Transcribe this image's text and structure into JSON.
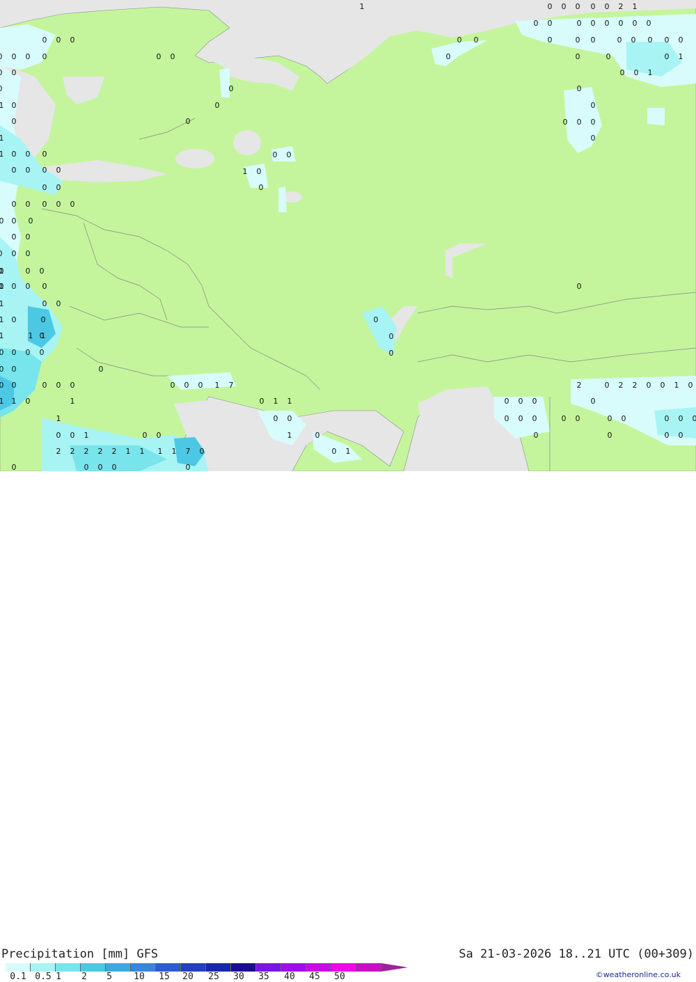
{
  "map": {
    "land_color": "#c4f59c",
    "sea_color": "#e6e6e6",
    "precip_values": [
      {
        "v": "0"
      },
      {
        "v": "0"
      },
      {
        "v": "0"
      },
      {
        "v": "0"
      },
      {
        "v": "0"
      },
      {
        "v": "0"
      },
      {
        "v": "0"
      },
      {
        "v": "0"
      },
      {
        "v": "0"
      },
      {
        "v": "0"
      },
      {
        "v": "0"
      },
      {
        "v": "0"
      },
      {
        "v": "0"
      },
      {
        "v": "0"
      },
      {
        "v": "0"
      },
      {
        "v": "0"
      },
      {
        "v": "0"
      },
      {
        "v": "0"
      },
      {
        "v": "0"
      },
      {
        "v": "0"
      },
      {
        "v": "0"
      },
      {
        "v": "0"
      },
      {
        "v": "0"
      },
      {
        "v": "0"
      },
      {
        "v": "0"
      },
      {
        "v": "0"
      },
      {
        "v": "0"
      },
      {
        "v": "1"
      },
      {
        "v": "0"
      },
      {
        "v": "0"
      },
      {
        "v": "1"
      },
      {
        "v": "0"
      },
      {
        "v": "0"
      },
      {
        "v": "0"
      },
      {
        "v": "0"
      },
      {
        "v": "0"
      },
      {
        "v": "0"
      },
      {
        "v": "0"
      },
      {
        "v": "0"
      },
      {
        "v": "0"
      },
      {
        "v": "0"
      },
      {
        "v": "0"
      },
      {
        "v": "1"
      },
      {
        "v": "0"
      },
      {
        "v": "0"
      },
      {
        "v": "0"
      },
      {
        "v": "0"
      },
      {
        "v": "0"
      },
      {
        "v": "0"
      },
      {
        "v": "1"
      },
      {
        "v": "0"
      },
      {
        "v": "0"
      },
      {
        "v": "0"
      },
      {
        "v": "0"
      },
      {
        "v": "0"
      },
      {
        "v": "1"
      },
      {
        "v": "0"
      },
      {
        "v": "0"
      },
      {
        "v": "0"
      },
      {
        "v": "0"
      },
      {
        "v": "0"
      },
      {
        "v": "0"
      },
      {
        "v": "0"
      },
      {
        "v": "0"
      },
      {
        "v": "0"
      },
      {
        "v": "0"
      },
      {
        "v": "0"
      },
      {
        "v": "0"
      },
      {
        "v": "0"
      },
      {
        "v": "0"
      },
      {
        "v": "0"
      },
      {
        "v": "0"
      },
      {
        "v": "0"
      },
      {
        "v": "0"
      },
      {
        "v": "0"
      },
      {
        "v": "0"
      },
      {
        "v": "0"
      },
      {
        "v": "0"
      },
      {
        "v": "0"
      },
      {
        "v": "0"
      },
      {
        "v": "0"
      },
      {
        "v": "0"
      },
      {
        "v": "0"
      },
      {
        "v": "1"
      },
      {
        "v": "0"
      },
      {
        "v": "0"
      },
      {
        "v": "0"
      },
      {
        "v": "0"
      },
      {
        "v": "0"
      },
      {
        "v": "0"
      },
      {
        "v": "1"
      },
      {
        "v": "1"
      },
      {
        "v": "1"
      },
      {
        "v": "1"
      },
      {
        "v": "0"
      },
      {
        "v": "1"
      },
      {
        "v": "1"
      },
      {
        "v": "0"
      },
      {
        "v": "0"
      },
      {
        "v": "0"
      },
      {
        "v": "0"
      },
      {
        "v": "0"
      },
      {
        "v": "0"
      },
      {
        "v": "0"
      },
      {
        "v": "0"
      },
      {
        "v": "0"
      },
      {
        "v": "0"
      },
      {
        "v": "0"
      },
      {
        "v": "0"
      },
      {
        "v": "1"
      },
      {
        "v": "0"
      },
      {
        "v": "0"
      },
      {
        "v": "0"
      },
      {
        "v": "0"
      },
      {
        "v": "0"
      },
      {
        "v": "0"
      },
      {
        "v": "0"
      },
      {
        "v": "1"
      },
      {
        "v": "7"
      },
      {
        "v": "2"
      },
      {
        "v": "0"
      },
      {
        "v": "2"
      },
      {
        "v": "2"
      },
      {
        "v": "0"
      },
      {
        "v": "0"
      },
      {
        "v": "1"
      },
      {
        "v": "0"
      },
      {
        "v": "1"
      },
      {
        "v": "1"
      },
      {
        "v": "0"
      },
      {
        "v": "1"
      },
      {
        "v": "0"
      },
      {
        "v": "1"
      },
      {
        "v": "1"
      },
      {
        "v": "0"
      },
      {
        "v": "0"
      },
      {
        "v": "0"
      },
      {
        "v": "0"
      },
      {
        "v": "1"
      },
      {
        "v": "0"
      },
      {
        "v": "0"
      },
      {
        "v": "0"
      },
      {
        "v": "0"
      },
      {
        "v": "0"
      },
      {
        "v": "0"
      },
      {
        "v": "0"
      },
      {
        "v": "0"
      },
      {
        "v": "0"
      },
      {
        "v": "0"
      },
      {
        "v": "0"
      },
      {
        "v": "0"
      },
      {
        "v": "0"
      },
      {
        "v": "0"
      },
      {
        "v": "1"
      },
      {
        "v": "0"
      },
      {
        "v": "0"
      },
      {
        "v": "1"
      },
      {
        "v": "0"
      },
      {
        "v": "0"
      },
      {
        "v": "0"
      },
      {
        "v": "0"
      },
      {
        "v": "0"
      },
      {
        "v": "2"
      },
      {
        "v": "2"
      },
      {
        "v": "2"
      },
      {
        "v": "2"
      },
      {
        "v": "2"
      },
      {
        "v": "1"
      },
      {
        "v": "1"
      },
      {
        "v": "1"
      },
      {
        "v": "1"
      },
      {
        "v": "7"
      },
      {
        "v": "0"
      },
      {
        "v": "0"
      },
      {
        "v": "1"
      },
      {
        "v": "0"
      },
      {
        "v": "0"
      },
      {
        "v": "0"
      },
      {
        "v": "0"
      },
      {
        "v": "0"
      },
      {
        "v": "1"
      },
      {
        "v": "0"
      },
      {
        "v": "0"
      },
      {
        "v": "0"
      },
      {
        "v": "0"
      },
      {
        "v": "0"
      },
      {
        "v": "2"
      },
      {
        "v": "1"
      }
    ]
  },
  "legend": {
    "title": "Precipitation [mm] GFS",
    "time": "Sa 21-03-2026 18..21 UTC (00+309)",
    "credit": "©weatheronline.co.uk",
    "colors": [
      "#d8fcfc",
      "#a8f4f4",
      "#78e4ec",
      "#4cc8e4",
      "#3ca8e0",
      "#3c84dc",
      "#2c5cd0",
      "#2440bc",
      "#1828a8",
      "#1c0c90",
      "#7c14e4",
      "#a00cec",
      "#c80ce4",
      "#ec08e8",
      "#c810c0",
      "#a020a0"
    ],
    "ticks": [
      "0.1",
      "0.5",
      "1",
      "2",
      "5",
      "10",
      "15",
      "20",
      "25",
      "30",
      "35",
      "40",
      "45",
      "50"
    ]
  }
}
